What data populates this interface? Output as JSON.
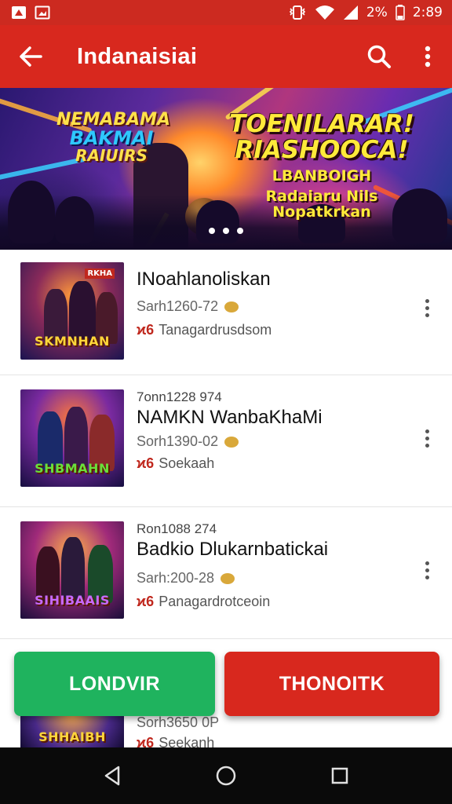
{
  "status_bar": {
    "left_icons": [
      "app-icon",
      "gallery-icon"
    ],
    "right_icons": [
      "vibrate-icon",
      "wifi-icon",
      "signal-icon"
    ],
    "battery_text": "2%",
    "battery_icon": "battery-icon",
    "time": "2:89"
  },
  "app_bar": {
    "back_icon": "back-arrow-icon",
    "title": "Indanaisiai",
    "search_icon": "search-icon",
    "menu_icon": "overflow-menu-icon",
    "color": "#d8281e"
  },
  "banner": {
    "left_text": [
      "NEMABAMA",
      "BAKMAI",
      "RAIUIRS"
    ],
    "right_text": [
      "TOENILARAR!",
      "RIASHOOCA!",
      "LBANBOIGH",
      "Radaiaru Nils Nopatkrkan"
    ],
    "page_dots": 3
  },
  "list": [
    {
      "meta_top": "",
      "title": "INoahlanoliskan",
      "subtitle": "Sarh1260-72",
      "tag_mark": "ϰ6",
      "tag_text": "Tanagardrusdsom",
      "thumb_logo": "SKMNHAN",
      "thumb_badge": "RKHA"
    },
    {
      "meta_top": "7onn1228 974",
      "title": "NAMKN WanbaKhaMi",
      "subtitle": "Sorh1390-02",
      "tag_mark": "ϰ6",
      "tag_text": "Soekaah",
      "thumb_logo": "SHBMAHN"
    },
    {
      "meta_top": "Ron1088 274",
      "title": "Badkio Dlukarnbatickai",
      "subtitle": "Sarh:200-28",
      "tag_mark": "ϰ6",
      "tag_text": "Panagardrotceoin",
      "thumb_logo": "SIHIBAAIS"
    },
    {
      "meta_top": "",
      "title": "",
      "subtitle": "Sorh3650 0P",
      "tag_mark": "ϰ6",
      "tag_text": "Seekanh",
      "thumb_logo": "SHHAIBH"
    }
  ],
  "buttons": {
    "primary_label": "LONDVIR",
    "secondary_label": "THONOITK",
    "primary_color": "#1fb35e",
    "secondary_color": "#d8281e"
  },
  "nav_bar": {
    "back_icon": "nav-back-icon",
    "home_icon": "nav-home-icon",
    "recents_icon": "nav-recents-icon"
  }
}
